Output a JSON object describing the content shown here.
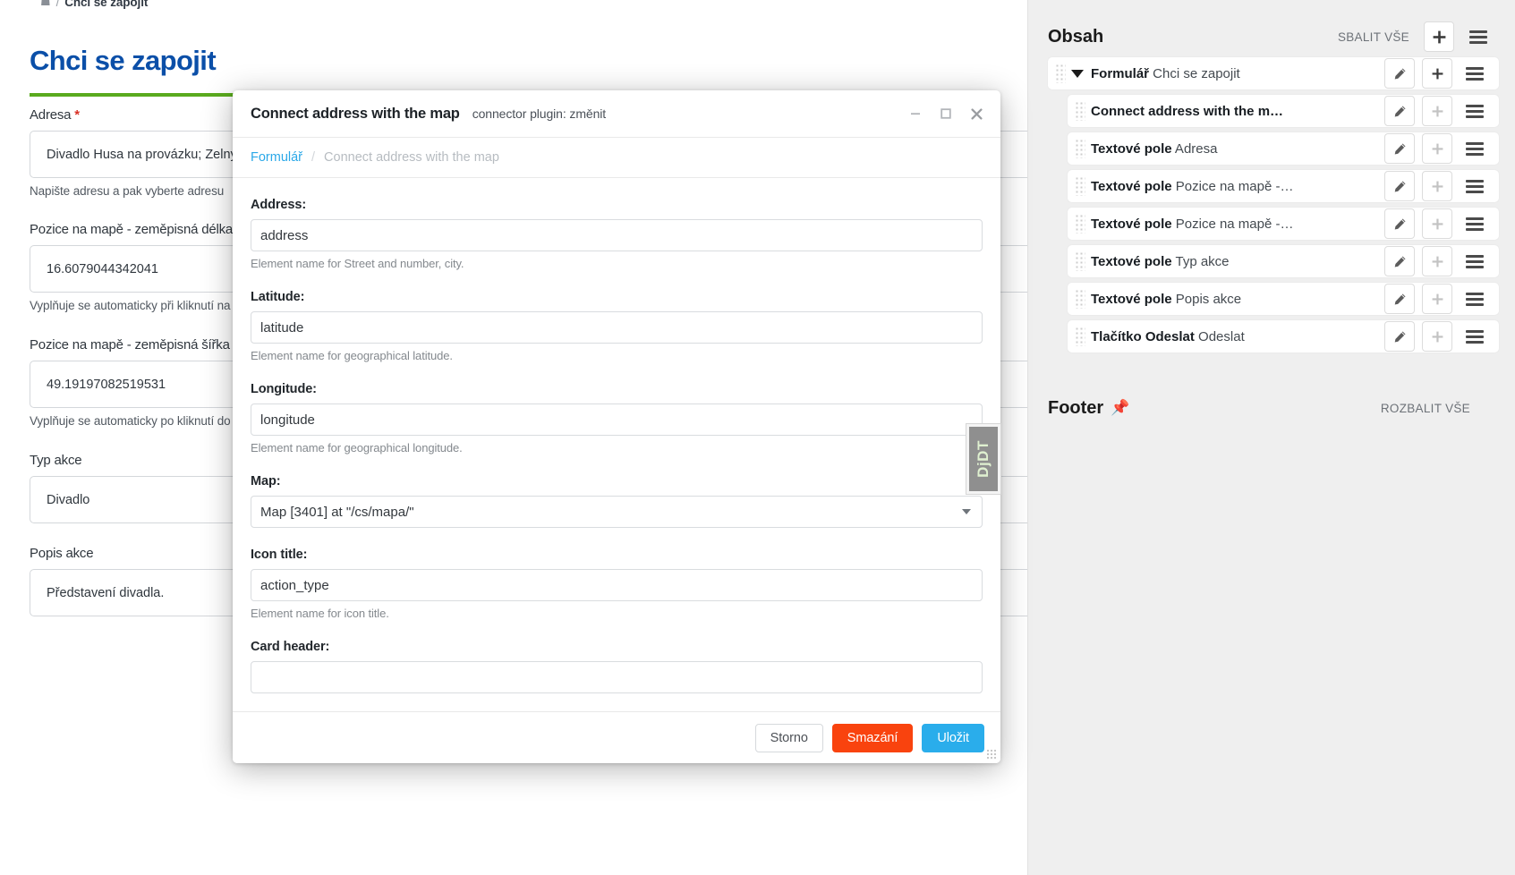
{
  "page": {
    "breadcrumb": {
      "home_icon": "home-icon",
      "separator": "/",
      "current": "Chci se zapojit"
    },
    "title": "Chci se zapojit",
    "fields": [
      {
        "label": "Adresa",
        "required_marker": "*",
        "value": "Divadlo Husa na provázku; Zelný trh",
        "help": "Napište adresu a pak vyberte adresu"
      },
      {
        "label": "Pozice na mapě - zeměpisná délka",
        "required_marker": "",
        "value": "16.6079044342041",
        "help": "Vyplňuje se automaticky při kliknutí na mapu"
      },
      {
        "label": "Pozice na mapě - zeměpisná šířka",
        "required_marker": "",
        "value": "49.19197082519531",
        "help": "Vyplňuje se automaticky po kliknutí do mapy"
      },
      {
        "label": "Typ akce",
        "required_marker": "",
        "value": "Divadlo",
        "help": ""
      },
      {
        "label": "Popis akce",
        "required_marker": "",
        "value": "Představení divadla.",
        "help": ""
      }
    ]
  },
  "sidebar": {
    "content_panel": {
      "title": "Obsah",
      "collapse_all_label": "SBALIT VŠE",
      "add_icon": "plus-icon",
      "menu_icon": "hamburger-icon"
    },
    "tree": [
      {
        "type": "Formulář",
        "name": "Chci se zapojit",
        "level": 0,
        "has_caret": true,
        "add_enabled": true,
        "edit_icon": "pencil-icon",
        "add_icon": "plus-icon",
        "menu_icon": "hamburger-icon"
      },
      {
        "type": "Connect address with the m…",
        "name": "",
        "level": 1,
        "has_caret": false,
        "add_enabled": false,
        "edit_icon": "pencil-icon",
        "add_icon": "plus-icon",
        "menu_icon": "hamburger-icon"
      },
      {
        "type": "Textové pole",
        "name": "Adresa",
        "level": 1,
        "has_caret": false,
        "add_enabled": false,
        "edit_icon": "pencil-icon",
        "add_icon": "plus-icon",
        "menu_icon": "hamburger-icon"
      },
      {
        "type": "Textové pole",
        "name": "Pozice na mapě -…",
        "level": 1,
        "has_caret": false,
        "add_enabled": false,
        "edit_icon": "pencil-icon",
        "add_icon": "plus-icon",
        "menu_icon": "hamburger-icon"
      },
      {
        "type": "Textové pole",
        "name": "Pozice na mapě -…",
        "level": 1,
        "has_caret": false,
        "add_enabled": false,
        "edit_icon": "pencil-icon",
        "add_icon": "plus-icon",
        "menu_icon": "hamburger-icon"
      },
      {
        "type": "Textové pole",
        "name": "Typ akce",
        "level": 1,
        "has_caret": false,
        "add_enabled": false,
        "edit_icon": "pencil-icon",
        "add_icon": "plus-icon",
        "menu_icon": "hamburger-icon"
      },
      {
        "type": "Textové pole",
        "name": "Popis akce",
        "level": 1,
        "has_caret": false,
        "add_enabled": false,
        "edit_icon": "pencil-icon",
        "add_icon": "plus-icon",
        "menu_icon": "hamburger-icon"
      },
      {
        "type": "Tlačítko Odeslat",
        "name": "Odeslat",
        "level": 1,
        "has_caret": false,
        "add_enabled": false,
        "edit_icon": "pencil-icon",
        "add_icon": "plus-icon",
        "menu_icon": "hamburger-icon"
      }
    ],
    "footer_panel": {
      "title": "Footer",
      "pin_icon": "pin-icon",
      "expand_all_label": "ROZBALIT VŠE"
    }
  },
  "modal": {
    "title": "Connect address with the map",
    "subtitle": "connector plugin: změnit",
    "window_controls": {
      "minimize_icon": "minimize-icon",
      "maximize_icon": "maximize-icon",
      "close_icon": "close-icon"
    },
    "breadcrumb": {
      "root": "Formulář",
      "separator": "/",
      "current": "Connect address with the map"
    },
    "fields": [
      {
        "label": "Address:",
        "value": "address",
        "help": "Element name for Street and number, city.",
        "control": "text"
      },
      {
        "label": "Latitude:",
        "value": "latitude",
        "help": "Element name for geographical latitude.",
        "control": "text"
      },
      {
        "label": "Longitude:",
        "value": "longitude",
        "help": "Element name for geographical longitude.",
        "control": "text"
      },
      {
        "label": "Map:",
        "value": "Map [3401] at \"/cs/mapa/\"",
        "help": "",
        "control": "select"
      },
      {
        "label": "Icon title:",
        "value": "action_type",
        "help": "Element name for icon title.",
        "control": "text"
      },
      {
        "label": "Card header:",
        "value": "",
        "help": "",
        "control": "text"
      }
    ],
    "buttons": {
      "cancel": "Storno",
      "delete": "Smazání",
      "save": "Uložit"
    }
  },
  "debug_toolbar": {
    "label": "DjDT"
  },
  "colors": {
    "page_title": "#0b4fa8",
    "accent_rule": "#5aaa1e",
    "primary": "#2aadeb",
    "danger": "#f9430e",
    "required": "#d93025",
    "sidebar_bg": "#efefef"
  }
}
